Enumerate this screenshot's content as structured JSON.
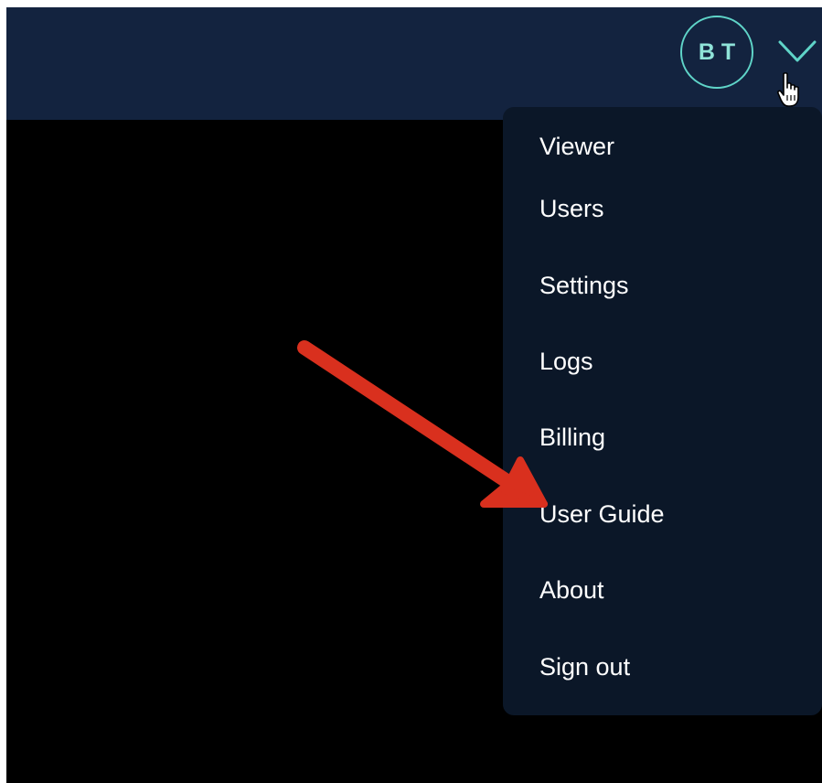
{
  "header": {
    "avatar_initials": "BT",
    "avatar_color": "#5fd4c8",
    "dropdown_icon": "chevron-down-icon",
    "background_color": "#13233f"
  },
  "menu": {
    "background_color": "#0b1728",
    "items": [
      {
        "label": "Viewer"
      },
      {
        "label": "Users"
      },
      {
        "label": "Settings"
      },
      {
        "label": "Logs"
      },
      {
        "label": "Billing"
      },
      {
        "label": "User Guide"
      },
      {
        "label": "About"
      },
      {
        "label": "Sign out"
      }
    ]
  },
  "annotation": {
    "arrow_color": "#d9301e",
    "points_to": "User Guide"
  }
}
